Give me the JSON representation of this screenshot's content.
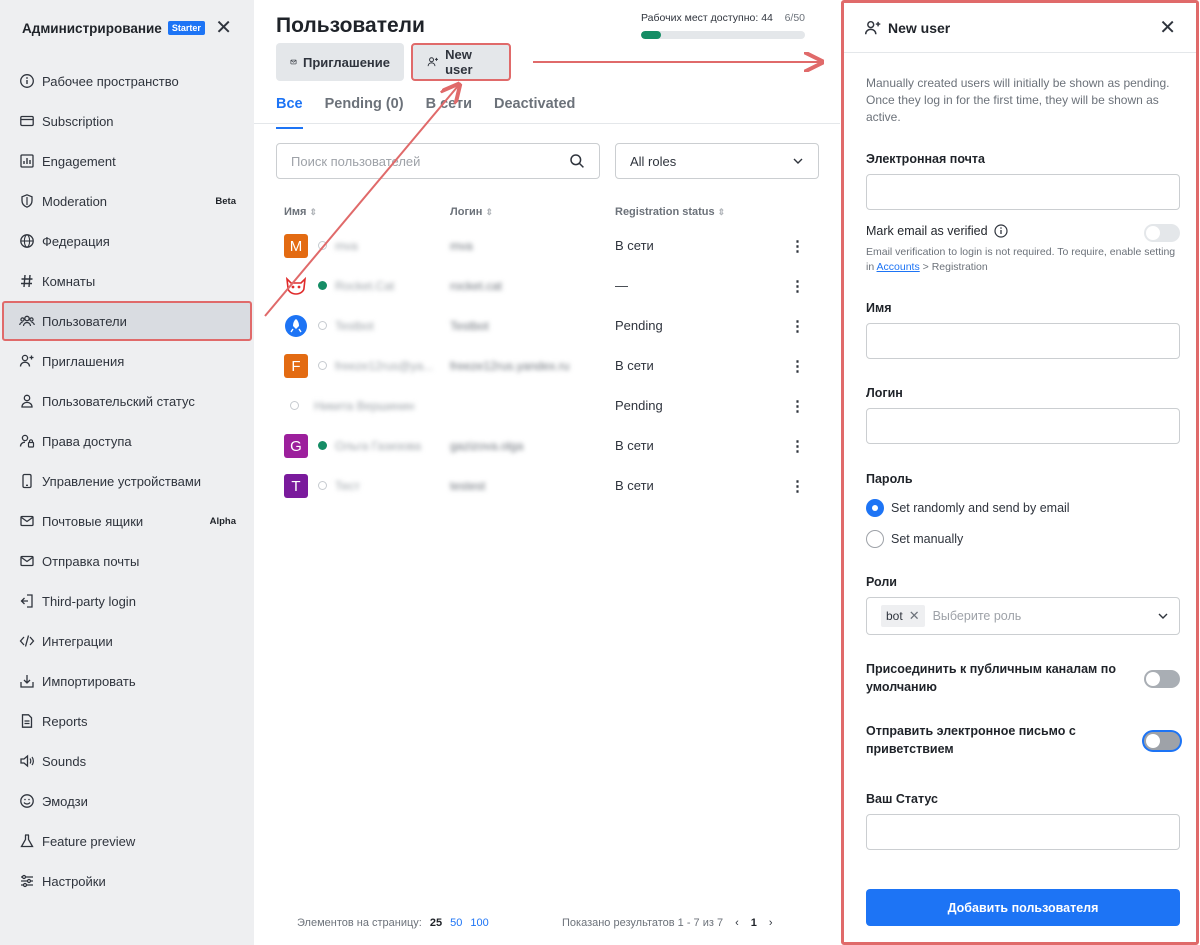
{
  "sidebar": {
    "title": "Администрирование",
    "badge": "Starter",
    "items": [
      {
        "label": "Рабочее пространство",
        "icon": "info-icon"
      },
      {
        "label": "Subscription",
        "icon": "card-icon"
      },
      {
        "label": "Engagement",
        "icon": "chart-icon"
      },
      {
        "label": "Moderation",
        "icon": "shield-icon",
        "tag": "Beta"
      },
      {
        "label": "Федерация",
        "icon": "globe-icon"
      },
      {
        "label": "Комнаты",
        "icon": "hash-icon"
      },
      {
        "label": "Пользователи",
        "icon": "team-icon"
      },
      {
        "label": "Приглашения",
        "icon": "user-plus-icon"
      },
      {
        "label": "Пользовательский статус",
        "icon": "user-icon"
      },
      {
        "label": "Права доступа",
        "icon": "user-lock-icon"
      },
      {
        "label": "Управление устройствами",
        "icon": "mobile-icon"
      },
      {
        "label": "Почтовые ящики",
        "icon": "mail-icon",
        "tag": "Alpha"
      },
      {
        "label": "Отправка почты",
        "icon": "mail-send-icon"
      },
      {
        "label": "Third-party login",
        "icon": "login-icon"
      },
      {
        "label": "Интеграции",
        "icon": "code-icon"
      },
      {
        "label": "Импортировать",
        "icon": "import-icon"
      },
      {
        "label": "Reports",
        "icon": "file-icon"
      },
      {
        "label": "Sounds",
        "icon": "volume-icon"
      },
      {
        "label": "Эмодзи",
        "icon": "emoji-icon"
      },
      {
        "label": "Feature preview",
        "icon": "flask-icon"
      },
      {
        "label": "Настройки",
        "icon": "sliders-icon"
      }
    ]
  },
  "main": {
    "title": "Пользователи",
    "seats_label": "Рабочих мест доступно: 44",
    "seats_count": "6/50",
    "seats_fraction": 0.12,
    "invite_label": "Приглашение",
    "new_user_label": "New user",
    "tabs": [
      "Все",
      "Pending (0)",
      "В сети",
      "Deactivated"
    ],
    "search_placeholder": "Поиск пользователей",
    "roles_filter": "All roles",
    "columns": [
      "Имя",
      "Логин",
      "Registration status"
    ],
    "rows": [
      {
        "avatar": "M",
        "color": "#e36b12",
        "status": "offline",
        "name": "mva",
        "login": "mva",
        "reg": "В сети"
      },
      {
        "avatar": "",
        "color": "cat",
        "status": "online",
        "name": "Rocket.Cat",
        "login": "rocket.cat",
        "reg": "—"
      },
      {
        "avatar": "",
        "color": "rocket",
        "status": "offline",
        "name": "Testbot",
        "login": "Testbot",
        "reg": "Pending"
      },
      {
        "avatar": "F",
        "color": "#e36b12",
        "status": "offline",
        "name": "freeze12rus@ya...",
        "login": "freeze12rus.yandex.ru",
        "reg": "В сети"
      },
      {
        "avatar": "",
        "color": "none",
        "status": "offline",
        "name": "Никита Вершинин",
        "login": "",
        "reg": "Pending"
      },
      {
        "avatar": "G",
        "color": "#9c1f9c",
        "status": "online",
        "name": "Ольга Газизова",
        "login": "gazizova.olga",
        "reg": "В сети"
      },
      {
        "avatar": "T",
        "color": "#7a1a9c",
        "status": "offline",
        "name": "Тест",
        "login": "testest",
        "reg": "В сети"
      }
    ],
    "footer": {
      "per_page_label": "Элементов на страницу:",
      "per_page_options": [
        "25",
        "50",
        "100"
      ],
      "results": "Показано результатов 1 - 7 из 7",
      "prev": "‹",
      "page": "1",
      "next": "›"
    }
  },
  "panel": {
    "title": "New user",
    "hint": "Manually created users will initially be shown as pending. Once they log in for the first time, they will be shown as active.",
    "email_label": "Электронная почта",
    "verified_label": "Mark email as verified",
    "verified_hint_1": "Email verification to login is not required. To require, enable setting in",
    "verified_hint_link": "Accounts",
    "verified_hint_2": "> Registration",
    "name_label": "Имя",
    "login_label": "Логин",
    "password_label": "Пароль",
    "password_opt1": "Set randomly and send by email",
    "password_opt2": "Set manually",
    "roles_label": "Роли",
    "role_chip": "bot",
    "roles_placeholder": "Выберите роль",
    "join_default_label": "Присоединить к публичным каналам по умолчанию",
    "welcome_email_label": "Отправить электронное письмо с приветствием",
    "status_label": "Ваш Статус",
    "submit_label": "Добавить пользователя"
  },
  "colors": {
    "accent": "#1d74f5",
    "annotation": "#e06a6a",
    "online": "#158d65"
  }
}
